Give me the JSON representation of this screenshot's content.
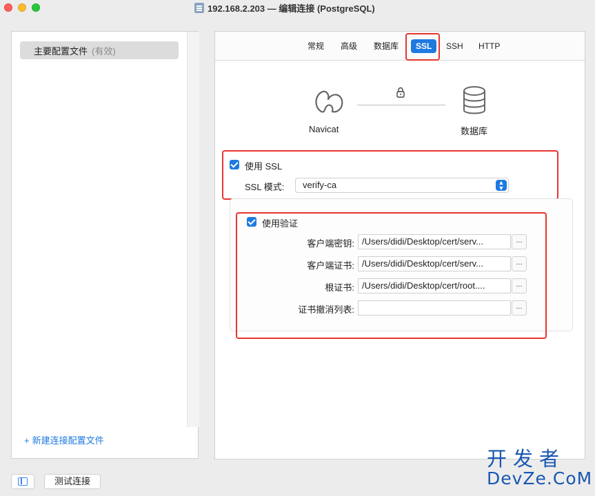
{
  "window": {
    "title": "192.168.2.203 — 编辑连接 (PostgreSQL)"
  },
  "sidebar": {
    "profile_name": "主要配置文件",
    "profile_state": "(有效)",
    "new_profile_label": "新建连接配置文件"
  },
  "tabs": [
    "常规",
    "高级",
    "数据库",
    "SSL",
    "SSH",
    "HTTP"
  ],
  "active_tab": "SSL",
  "diagram": {
    "left_label": "Navicat",
    "right_label": "数据库"
  },
  "ssl": {
    "use_ssl_label": "使用 SSL",
    "use_ssl_checked": true,
    "mode_label": "SSL 模式:",
    "mode_value": "verify-ca"
  },
  "verify": {
    "use_auth_label": "使用验证",
    "use_auth_checked": true,
    "fields": [
      {
        "label": "客户端密钥:",
        "value": "/Users/didi/Desktop/cert/serv..."
      },
      {
        "label": "客户端证书:",
        "value": "/Users/didi/Desktop/cert/serv..."
      },
      {
        "label": "根证书:",
        "value": "/Users/didi/Desktop/cert/root...."
      },
      {
        "label": "证书撤消列表:",
        "value": ""
      }
    ],
    "browse_label": "..."
  },
  "footer": {
    "test_button": "测试连接"
  },
  "watermark": {
    "top": "开发者",
    "bottom": "DevZe.CoM"
  },
  "colors": {
    "accent": "#1f7ae0",
    "highlight": "#e8332d"
  }
}
